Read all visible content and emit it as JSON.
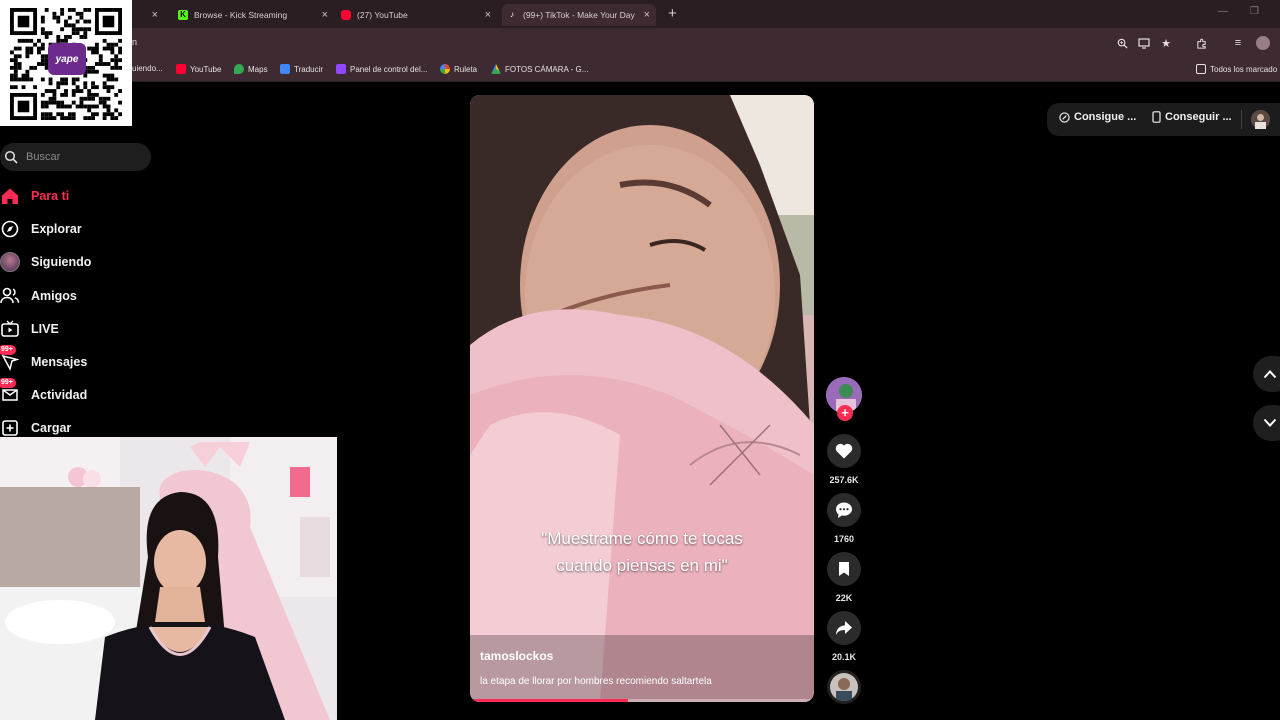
{
  "browser": {
    "tabs": [
      {
        "label": "Browse - Kick Streaming",
        "icon": "kick-icon",
        "color": "#53fc18"
      },
      {
        "label": "(27) YouTube",
        "icon": "youtube-icon",
        "color": "#ff0033"
      },
      {
        "label": "(99+) TikTok - Make Your Day",
        "icon": "tiktok-icon",
        "color": "#ffffff",
        "active": true
      }
    ],
    "new_tab": "+",
    "address_text": "n",
    "bookmarks": [
      {
        "label": "uiendo...",
        "color": "#9146ff"
      },
      {
        "label": "YouTube",
        "color": "#ff0033"
      },
      {
        "label": "Maps",
        "color": "#34a853"
      },
      {
        "label": "Traducir",
        "color": "#4285f4"
      },
      {
        "label": "Panel de control del...",
        "color": "#9146ff"
      },
      {
        "label": "Ruleta",
        "color": "#ea4335"
      },
      {
        "label": "FOTOS CÁMARA - G...",
        "color": "#fbbc04"
      }
    ],
    "all_bookmarks": "Todos los marcado"
  },
  "qr": {
    "brand": "yape",
    "accent": "#6b2a8c"
  },
  "sidebar": {
    "search_placeholder": "Buscar",
    "items": [
      {
        "label": "Para ti",
        "icon": "home-icon",
        "active": true
      },
      {
        "label": "Explorar",
        "icon": "compass-icon"
      },
      {
        "label": "Siguiendo",
        "icon": "following-avatar-icon"
      },
      {
        "label": "Amigos",
        "icon": "friends-icon"
      },
      {
        "label": "LIVE",
        "icon": "live-tv-icon"
      },
      {
        "label": "Mensajes",
        "icon": "messages-icon",
        "badge": "99+"
      },
      {
        "label": "Actividad",
        "icon": "activity-icon",
        "badge": "99+"
      },
      {
        "label": "Cargar",
        "icon": "upload-icon"
      }
    ]
  },
  "video": {
    "caption_line1": "\"Muestrame cómo te tocas",
    "caption_line2": "cuando piensas en mi\"",
    "author": "tamoslockos",
    "description": "la etapa de llorar por hombres recomiendo saltartela",
    "progress": 0.46
  },
  "actions": {
    "likes": "257.6K",
    "comments": "1760",
    "saves": "22K",
    "shares": "20.1K"
  },
  "top_right": {
    "coins_label": "Consigue ...",
    "app_label": "Conseguir ..."
  },
  "colors": {
    "accent": "#fe2c55",
    "chrome": "#3d2b31",
    "tabbar": "#2b1e22"
  }
}
